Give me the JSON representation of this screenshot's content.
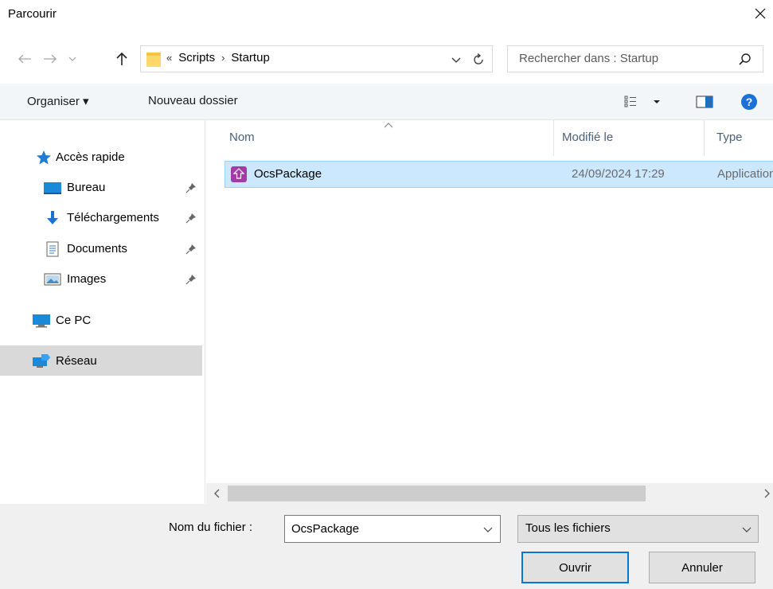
{
  "window": {
    "title": "Parcourir"
  },
  "address": {
    "overflow": "«",
    "crumbs": [
      "Scripts",
      "Startup"
    ],
    "separator": "›"
  },
  "search": {
    "placeholder": "Rechercher dans : Startup"
  },
  "toolbar": {
    "organize": "Organiser ▾",
    "new_folder": "Nouveau dossier"
  },
  "sidebar": {
    "quick_access": "Accès rapide",
    "items": [
      {
        "label": "Bureau",
        "icon": "desktop-icon",
        "pinned": true
      },
      {
        "label": "Téléchargements",
        "icon": "download-icon",
        "pinned": true
      },
      {
        "label": "Documents",
        "icon": "documents-icon",
        "pinned": true
      },
      {
        "label": "Images",
        "icon": "images-icon",
        "pinned": true
      }
    ],
    "this_pc": "Ce PC",
    "network": "Réseau"
  },
  "columns": {
    "name": "Nom",
    "modified": "Modifié le",
    "type": "Type"
  },
  "files": [
    {
      "name": "OcsPackage",
      "modified": "24/09/2024 17:29",
      "type": "Application",
      "selected": true
    }
  ],
  "footer": {
    "filename_label": "Nom du fichier :",
    "filename_value": "OcsPackage",
    "filter_value": "Tous les fichiers",
    "open_label": "Ouvrir",
    "cancel_label": "Annuler"
  },
  "colors": {
    "selection_bg": "#cce8ff",
    "selection_border": "#99d1ff",
    "accent": "#0078d7",
    "app_icon": "#a23aa8"
  }
}
